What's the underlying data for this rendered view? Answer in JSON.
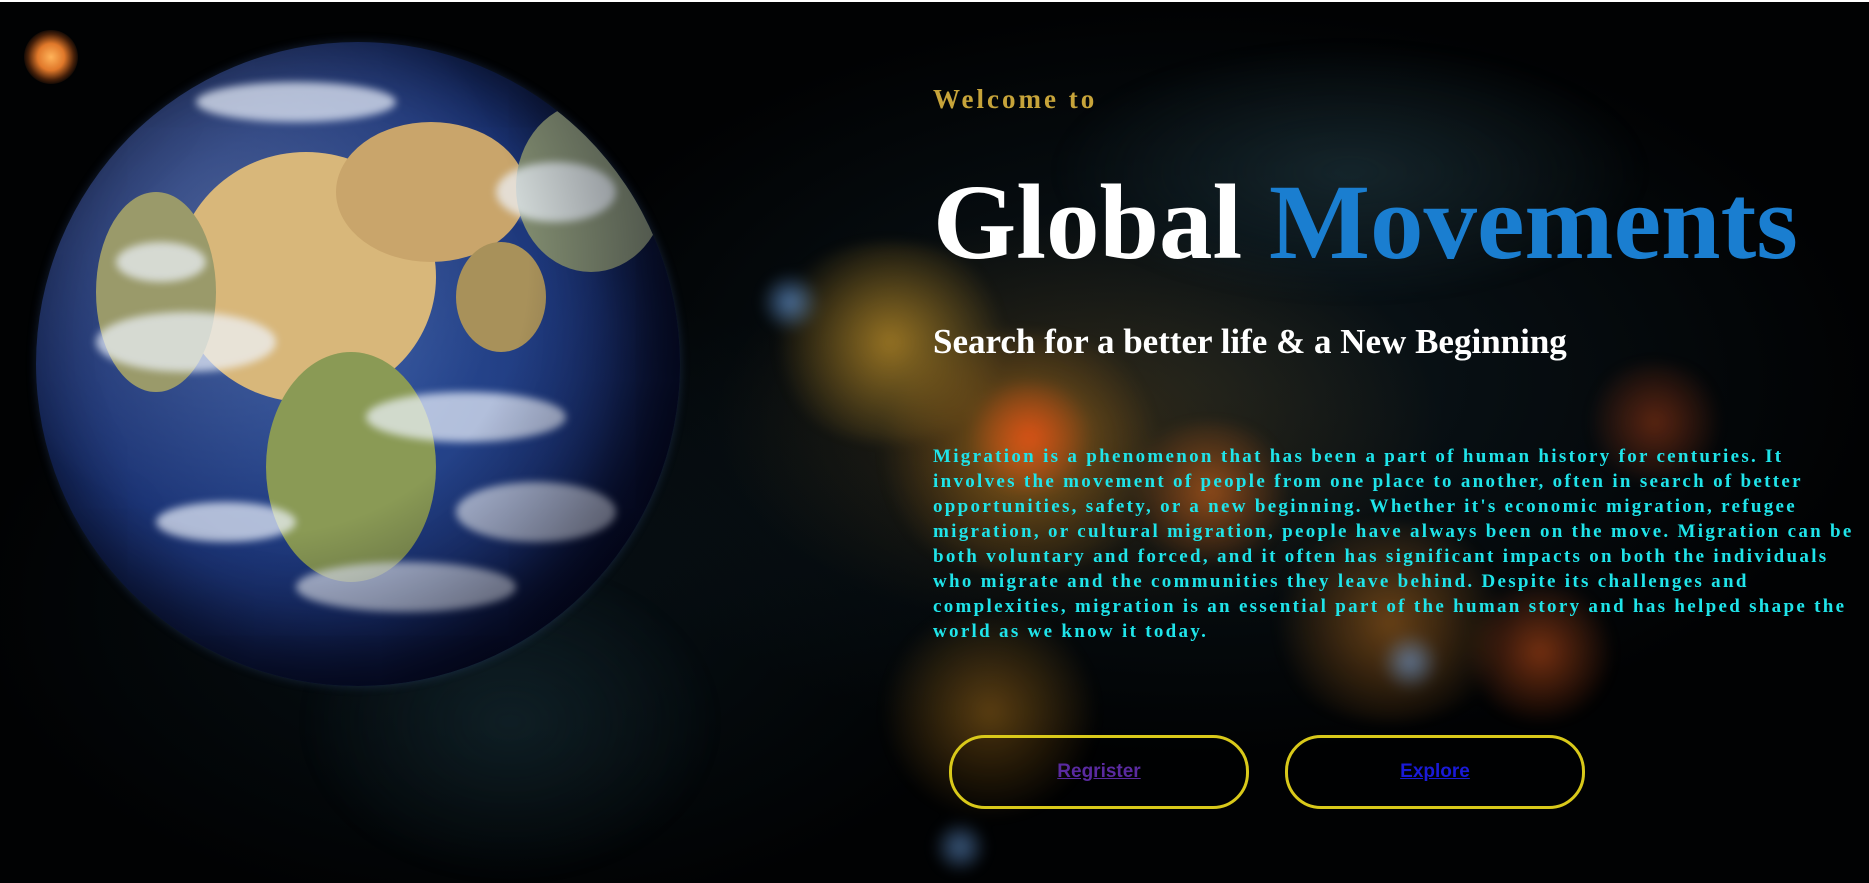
{
  "hero": {
    "welcome": "Welcome to",
    "title_part1": "Global",
    "title_part2": "Movements",
    "subtitle": "Search for a better life & a New Beginning",
    "description": "Migration is a phenomenon that has been a part of human history for centuries. It involves the movement of people from one place to another, often in search of better opportunities, safety, or a new beginning. Whether it's economic migration, refugee migration, or cultural migration, people have always been on the move. Migration can be both voluntary and forced, and it often has significant impacts on both the individuals who migrate and the communities they leave behind. Despite its challenges and complexities, migration is an essential part of the human story and has helped shape the world as we know it today."
  },
  "buttons": {
    "register_label": "Regrister",
    "explore_label": "Explore"
  },
  "colors": {
    "welcome": "#c7a43a",
    "title_accent": "#1a7ed0",
    "description": "#1fe4ea",
    "button_border": "#d9c91a",
    "background": "#010203"
  },
  "icons": {
    "earth": "earth-globe-image",
    "background": "world-migration-lights-map"
  }
}
